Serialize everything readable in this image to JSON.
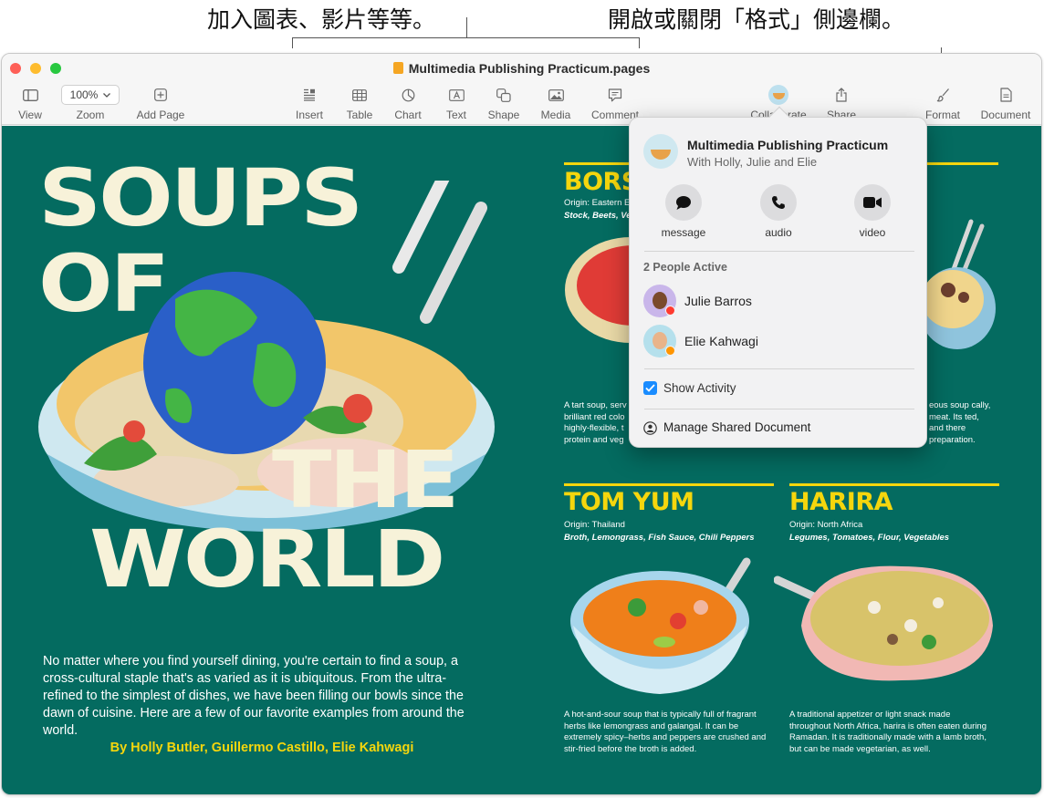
{
  "annotations": {
    "left": "加入圖表、影片等等。",
    "right": "開啟或關閉「格式」側邊欄。"
  },
  "window": {
    "title": "Multimedia Publishing Practicum.pages"
  },
  "toolbar": {
    "view": "View",
    "zoom_value": "100%",
    "zoom": "Zoom",
    "add_page": "Add Page",
    "insert": "Insert",
    "table": "Table",
    "chart": "Chart",
    "text": "Text",
    "shape": "Shape",
    "media": "Media",
    "comment": "Comment",
    "collaborate": "Collaborate",
    "share": "Share",
    "format": "Format",
    "document": "Document"
  },
  "colors": {
    "page_background": "#046b60",
    "headline": "#f7f2d9",
    "accent_yellow": "#f5d60d",
    "traffic_red": "#fe5f57",
    "traffic_yellow": "#febc2e",
    "traffic_green": "#28c840",
    "checkbox_blue": "#1a8cff"
  },
  "page": {
    "headline": {
      "line1": "SOUPS",
      "line2": "OF",
      "line3": "THE",
      "line4": "WORLD"
    },
    "intro": "No matter where you find yourself dining, you're certain to find a soup, a cross-cultural staple that's as varied as it is ubiquitous. From the ultra-refined to the simplest of dishes, we have been filling our bowls since the dawn of cuisine. Here are a few of our favorite examples from around the world.",
    "byline": "By Holly Butler, Guillermo Castillo, Elie Kahwagi",
    "soups": {
      "borscht": {
        "title": "BORS",
        "origin": "Origin: Eastern E",
        "ingredients": "Stock, Beets, Ve",
        "desc": "A tart soup, serv brilliant red colo highly-flexible, t protein and veg"
      },
      "right_top": {
        "desc": "eous soup cally, meat. Its ted, and there preparation."
      },
      "tom_yum": {
        "title": "TOM YUM",
        "origin": "Origin: Thailand",
        "ingredients": "Broth, Lemongrass, Fish Sauce, Chili Peppers",
        "desc": "A hot-and-sour soup that is typically full of fragrant herbs like lemongrass and galangal. It can be extremely spicy–herbs and peppers are crushed and stir-fried before the broth is added."
      },
      "harira": {
        "title": "HARIRA",
        "origin": "Origin: North Africa",
        "ingredients": "Legumes, Tomatoes, Flour, Vegetables",
        "desc": "A traditional appetizer or light snack made throughout North Africa, harira is often eaten during Ramadan. It is traditionally made with a lamb broth, but can be made vegetarian, as well."
      }
    }
  },
  "popover": {
    "doc_name": "Multimedia Publishing Practicum",
    "with_text": "With Holly, Julie and Elie",
    "actions": [
      {
        "label": "message",
        "icon": "message-icon"
      },
      {
        "label": "audio",
        "icon": "phone-icon"
      },
      {
        "label": "video",
        "icon": "video-icon"
      }
    ],
    "people_active": "2 People Active",
    "people": [
      {
        "name": "Julie Barros",
        "status_color": "#ff3b30"
      },
      {
        "name": "Elie Kahwagi",
        "status_color": "#ff9500"
      }
    ],
    "show_activity": "Show Activity",
    "show_activity_checked": true,
    "manage": "Manage Shared Document"
  }
}
